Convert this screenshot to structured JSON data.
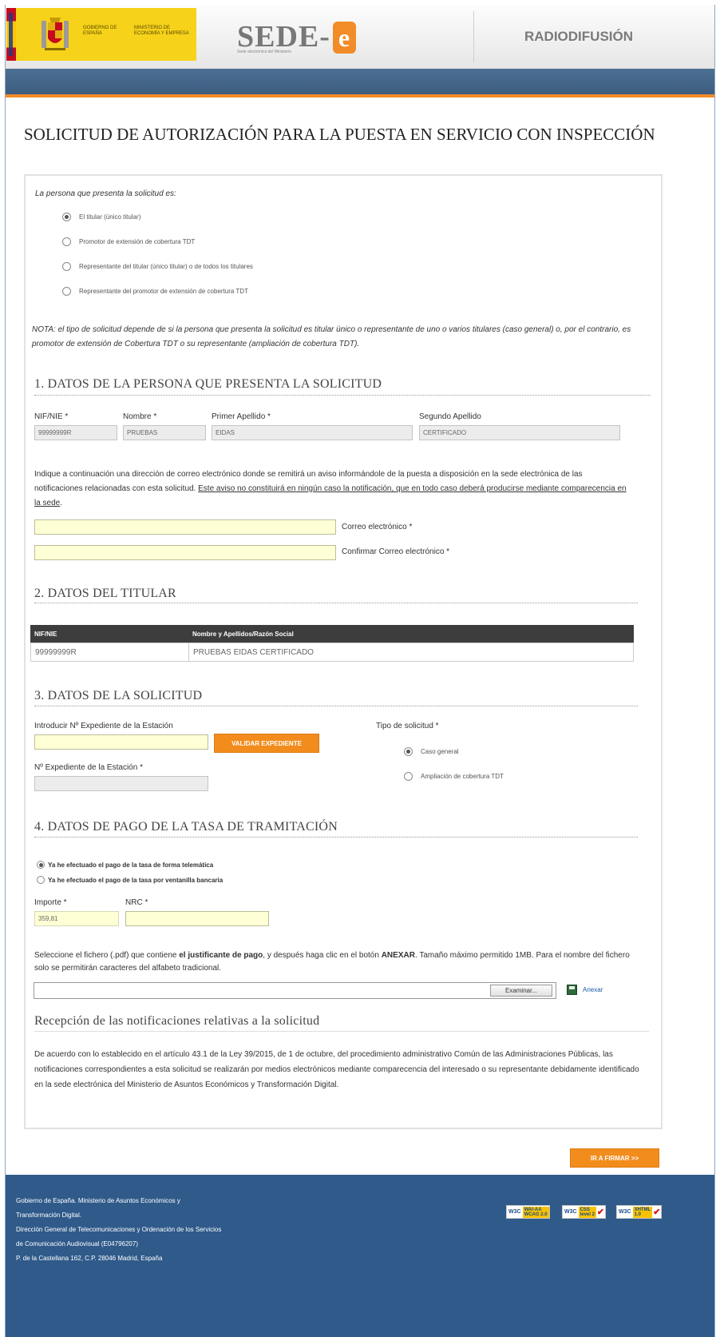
{
  "header": {
    "gov_text": "GOBIERNO DE ESPAÑA",
    "ministry_text": "MINISTERIO DE ECONOMÍA Y EMPRESA",
    "sede_text": "SEDE-",
    "sede_e": "e",
    "sede_sub": "Sede electrónica del Ministerio",
    "section_title": "RADIODIFUSIÓN"
  },
  "page_title": "SOLICITUD DE AUTORIZACIÓN PARA LA PUESTA EN SERVICIO CON INSPECCIÓN",
  "presenter": {
    "question": "La persona que presenta la solicitud es:",
    "options": [
      "El titular (único titular)",
      "Promotor de extensión de cobertura TDT",
      "Representante del titular (único titular) o de todos los titulares",
      "Representante del promotor de extensión de cobertura TDT"
    ],
    "selected_index": 0,
    "note": "NOTA: el tipo de solicitud depende de si la persona que presenta la solicitud es titular único o representante de uno o varios titulares (caso general) o, por el contrario, es promotor de extensión de Cobertura TDT o su representante (ampliación de cobertura TDT)."
  },
  "section1": {
    "title": "1. DATOS DE LA PERSONA QUE PRESENTA LA SOLICITUD",
    "nif_label": "NIF/NIE *",
    "nif_value": "99999999R",
    "nombre_label": "Nombre *",
    "nombre_value": "PRUEBAS",
    "apellido1_label": "Primer Apellido *",
    "apellido1_value": "EIDAS",
    "apellido2_label": "Segundo Apellido",
    "apellido2_value": "CERTIFICADO",
    "info_text": "Indique a continuación una dirección de correo electrónico donde se remitirá un aviso informándole de la puesta a disposición en la sede electrónica de las notificaciones relacionadas con esta solicitud.",
    "info_underlined": "Este aviso no constituirá en ningún caso la notificación, que en todo caso deberá producirse mediante comparecencia en la sede",
    "info_end": ".",
    "email_label": "Correo electrónico *",
    "email_confirm_label": "Confirmar Correo electrónico *",
    "email_value": "",
    "email_confirm_value": ""
  },
  "section2": {
    "title": "2. DATOS DEL TITULAR",
    "columns": [
      "NIF/NIE",
      "Nombre y Apellidos/Razón Social"
    ],
    "rows": [
      [
        "99999999R",
        "PRUEBAS EIDAS CERTIFICADO"
      ]
    ]
  },
  "section3": {
    "title": "3. DATOS DE LA SOLICITUD",
    "expediente_input_label": "Introducir Nº Expediente de la Estación",
    "validate_button": "VALIDAR EXPEDIENTE",
    "expediente_label": "Nº Expediente de la Estación *",
    "tipo_label": "Tipo de solicitud *",
    "tipo_options": [
      "Caso general",
      "Ampliación de cobertura TDT"
    ],
    "tipo_selected": 0
  },
  "section4": {
    "title": "4. DATOS DE PAGO DE LA TASA DE TRAMITACIÓN",
    "pay_options": [
      "Ya he efectuado el pago de la tasa de forma telemática",
      "Ya he efectuado el pago de la tasa por ventanilla bancaria"
    ],
    "pay_selected": 0,
    "importe_label": "Importe *",
    "importe_value": "359,81",
    "nrc_label": "NRC *",
    "nrc_value": "",
    "file_text_1": "Seleccione el fichero (.pdf) que contiene ",
    "file_text_bold1": "el justificante de pago",
    "file_text_2": ", y después haga clic en el botón ",
    "file_text_bold2": "ANEXAR",
    "file_text_3": ". Tamaño máximo permitido 1MB. Para el nombre del fichero solo se permitirán caracteres del alfabeto tradicional.",
    "browse_button": "Examinar...",
    "attach_link": "Anexar"
  },
  "notifications": {
    "title": "Recepción de las notificaciones relativas a la solicitud",
    "text": "De acuerdo con lo establecido en el artículo 43.1 de la Ley 39/2015, de 1 de octubre, del procedimiento administrativo Común de las Administraciones Públicas, las notificaciones correspondientes a esta solicitud se realizarán por medios electrónicos mediante comparecencia del interesado o su representante debidamente identificado en la sede electrónica del Ministerio de Asuntos Económicos y Transformación Digital."
  },
  "sign_button": "IR A FIRMAR >>",
  "footer": {
    "lines": [
      "Gobierno de España. Ministerio de Asuntos Económicos y",
      "Transformación Digital.",
      "Dirección General de Telecomunicaciones y Ordenación de los Servicios",
      "de Comunicación Audiovisual (E04796207)",
      "P. de la Castellana 162, C.P. 28046 Madrid, España"
    ],
    "badges": [
      {
        "w": "W3C",
        "b1": "WAI-AA",
        "b2": "WCAG 2.0"
      },
      {
        "w": "W3C",
        "b1": "CSS",
        "b2": "level 2"
      },
      {
        "w": "W3C",
        "b1": "XHTML",
        "b2": "1.0"
      }
    ]
  },
  "colors": {
    "accent_orange": "#f28c1d",
    "header_blue": "#3d5e80",
    "footer_blue": "#2f5a8a",
    "input_yellow": "#ffffd6"
  }
}
